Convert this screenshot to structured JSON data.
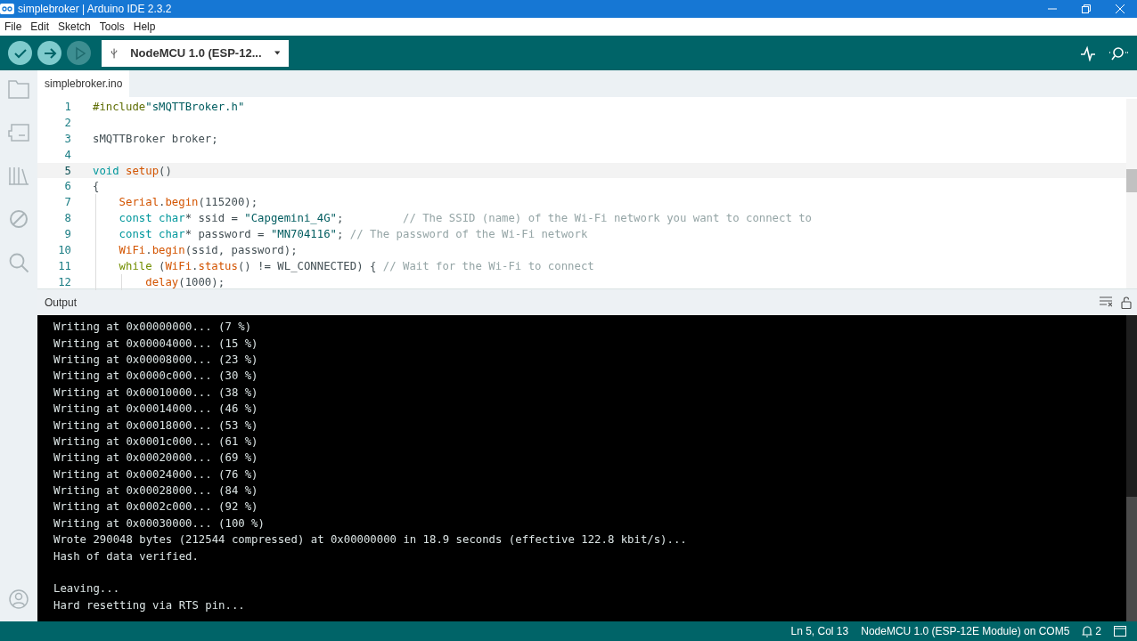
{
  "window": {
    "title": "simplebroker | Arduino IDE 2.3.2"
  },
  "menu": [
    "File",
    "Edit",
    "Sketch",
    "Tools",
    "Help"
  ],
  "toolbar": {
    "board": "NodeMCU 1.0 (ESP-12..."
  },
  "tabs": [
    {
      "label": "simplebroker.ino",
      "selected": true
    }
  ],
  "editor": {
    "lines": [
      {
        "number": "1",
        "current": false,
        "tokens": [
          {
            "kind": "preproc",
            "text": "#include"
          },
          {
            "kind": "string",
            "text": "\"sMQTTBroker.h\""
          }
        ]
      },
      {
        "number": "2",
        "current": false
      },
      {
        "number": "3",
        "current": false,
        "tokens": [
          {
            "kind": "plain",
            "text": "sMQTTBroker broker;"
          }
        ]
      },
      {
        "number": "4",
        "current": false
      },
      {
        "number": "5",
        "current": true,
        "tokens": [
          {
            "kind": "type",
            "text": "void "
          },
          {
            "kind": "function",
            "text": "setup"
          },
          {
            "kind": "plain",
            "text": "()"
          }
        ]
      },
      {
        "number": "6",
        "current": false,
        "tokens": [
          {
            "kind": "plain",
            "text": "{"
          }
        ]
      },
      {
        "number": "7",
        "current": false,
        "tokens": [
          {
            "kind": "class",
            "text": "    Serial"
          },
          {
            "kind": "plain",
            "text": "."
          },
          {
            "kind": "function",
            "text": "begin"
          },
          {
            "kind": "plain",
            "text": "(115200);"
          }
        ]
      },
      {
        "number": "8",
        "current": false,
        "tokens": [
          {
            "kind": "type",
            "text": "    const char"
          },
          {
            "kind": "plain",
            "text": "* ssid = "
          },
          {
            "kind": "string",
            "text": "\"Capgemini_4G\""
          },
          {
            "kind": "plain",
            "text": ";         "
          },
          {
            "kind": "comment",
            "text": "// The SSID (name) of the Wi-Fi network you want to connect to"
          }
        ]
      },
      {
        "number": "9",
        "current": false,
        "tokens": [
          {
            "kind": "type",
            "text": "    const char"
          },
          {
            "kind": "plain",
            "text": "* password = "
          },
          {
            "kind": "string",
            "text": "\"MN704116\""
          },
          {
            "kind": "plain",
            "text": "; "
          },
          {
            "kind": "comment",
            "text": "// The password of the Wi-Fi network"
          }
        ]
      },
      {
        "number": "10",
        "current": false,
        "tokens": [
          {
            "kind": "class",
            "text": "    WiFi"
          },
          {
            "kind": "plain",
            "text": "."
          },
          {
            "kind": "function",
            "text": "begin"
          },
          {
            "kind": "plain",
            "text": "(ssid, password);"
          }
        ]
      },
      {
        "number": "11",
        "current": false,
        "tokens": [
          {
            "kind": "keyword",
            "text": "    while"
          },
          {
            "kind": "plain",
            "text": " ("
          },
          {
            "kind": "class",
            "text": "WiFi"
          },
          {
            "kind": "plain",
            "text": "."
          },
          {
            "kind": "function",
            "text": "status"
          },
          {
            "kind": "plain",
            "text": "() != WL_CONNECTED) { "
          },
          {
            "kind": "comment",
            "text": "// Wait for the Wi-Fi to connect"
          }
        ]
      },
      {
        "number": "12",
        "current": false,
        "tokens": [
          {
            "kind": "function",
            "text": "        delay"
          },
          {
            "kind": "plain",
            "text": "(1000);"
          }
        ]
      }
    ]
  },
  "output": {
    "title": "Output",
    "lines": [
      {
        "text": "Writing at 0x00000000... (7 %)",
        "blank_before": false
      },
      {
        "text": "Writing at 0x00004000... (15 %)",
        "blank_before": false
      },
      {
        "text": "Writing at 0x00008000... (23 %)",
        "blank_before": false
      },
      {
        "text": "Writing at 0x0000c000... (30 %)",
        "blank_before": false
      },
      {
        "text": "Writing at 0x00010000... (38 %)",
        "blank_before": false
      },
      {
        "text": "Writing at 0x00014000... (46 %)",
        "blank_before": false
      },
      {
        "text": "Writing at 0x00018000... (53 %)",
        "blank_before": false
      },
      {
        "text": "Writing at 0x0001c000... (61 %)",
        "blank_before": false
      },
      {
        "text": "Writing at 0x00020000... (69 %)",
        "blank_before": false
      },
      {
        "text": "Writing at 0x00024000... (76 %)",
        "blank_before": false
      },
      {
        "text": "Writing at 0x00028000... (84 %)",
        "blank_before": false
      },
      {
        "text": "Writing at 0x0002c000... (92 %)",
        "blank_before": false
      },
      {
        "text": "Writing at 0x00030000... (100 %)",
        "blank_before": false
      },
      {
        "text": "Wrote 290048 bytes (212544 compressed) at 0x00000000 in 18.9 seconds (effective 122.8 kbit/s)...",
        "blank_before": false
      },
      {
        "text": "Hash of data verified.",
        "blank_before": false
      },
      {
        "text": "Leaving...",
        "blank_before": true
      },
      {
        "text": "Hard resetting via RTS pin...",
        "blank_before": false
      }
    ]
  },
  "status_bar": {
    "position": "Ln 5, Col 13",
    "board": "NodeMCU 1.0 (ESP-12E Module) on COM5",
    "notifications": "2"
  }
}
